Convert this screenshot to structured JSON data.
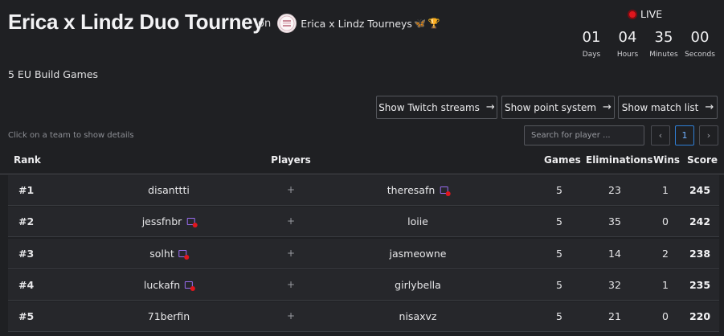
{
  "header": {
    "title": "Erica x Lindz Duo Tourney",
    "on_label": "on",
    "organizer_name": "Erica x Lindz Tourneys",
    "organizer_emoji": "🦋",
    "organizer_trophy": "🏆",
    "live_label": "LIVE",
    "subtitle": "5 EU Build Games"
  },
  "countdown": [
    {
      "value": "01",
      "label": "Days"
    },
    {
      "value": "04",
      "label": "Hours"
    },
    {
      "value": "35",
      "label": "Minutes"
    },
    {
      "value": "00",
      "label": "Seconds"
    }
  ],
  "actions": {
    "twitch_label": "Show Twitch streams",
    "points_label": "Show point system",
    "matchlist_label": "Show match list"
  },
  "table_controls": {
    "hint": "Click on a team to show details",
    "search_placeholder": "Search for player ...",
    "prev_icon": "‹",
    "current_page": "1",
    "next_icon": "›"
  },
  "columns": {
    "rank": "Rank",
    "players": "Players",
    "games": "Games",
    "eliminations": "Eliminations",
    "wins": "Wins",
    "score": "Score"
  },
  "rows": [
    {
      "rank": "#1",
      "p1": "disanttti",
      "p1_twitch": false,
      "plus": "+",
      "p2": "theresafn",
      "p2_twitch": true,
      "games": "5",
      "elims": "23",
      "wins": "1",
      "score": "245"
    },
    {
      "rank": "#2",
      "p1": "jessfnbr",
      "p1_twitch": true,
      "plus": "+",
      "p2": "loiie",
      "p2_twitch": false,
      "games": "5",
      "elims": "35",
      "wins": "0",
      "score": "242"
    },
    {
      "rank": "#3",
      "p1": "solht",
      "p1_twitch": true,
      "plus": "+",
      "p2": "jasmeowne",
      "p2_twitch": false,
      "games": "5",
      "elims": "14",
      "wins": "2",
      "score": "238"
    },
    {
      "rank": "#4",
      "p1": "luckafn",
      "p1_twitch": true,
      "plus": "+",
      "p2": "girlybella",
      "p2_twitch": false,
      "games": "5",
      "elims": "32",
      "wins": "1",
      "score": "235"
    },
    {
      "rank": "#5",
      "p1": "71berfin",
      "p1_twitch": false,
      "plus": "+",
      "p2": "nisaxvz",
      "p2_twitch": false,
      "games": "5",
      "elims": "21",
      "wins": "0",
      "score": "220"
    }
  ],
  "colors": {
    "background": "#1f2023",
    "row_background": "#26272b",
    "live_red": "#e0161d",
    "twitch_purple": "#9b6df2",
    "page_active_blue": "#2f7fd6"
  }
}
